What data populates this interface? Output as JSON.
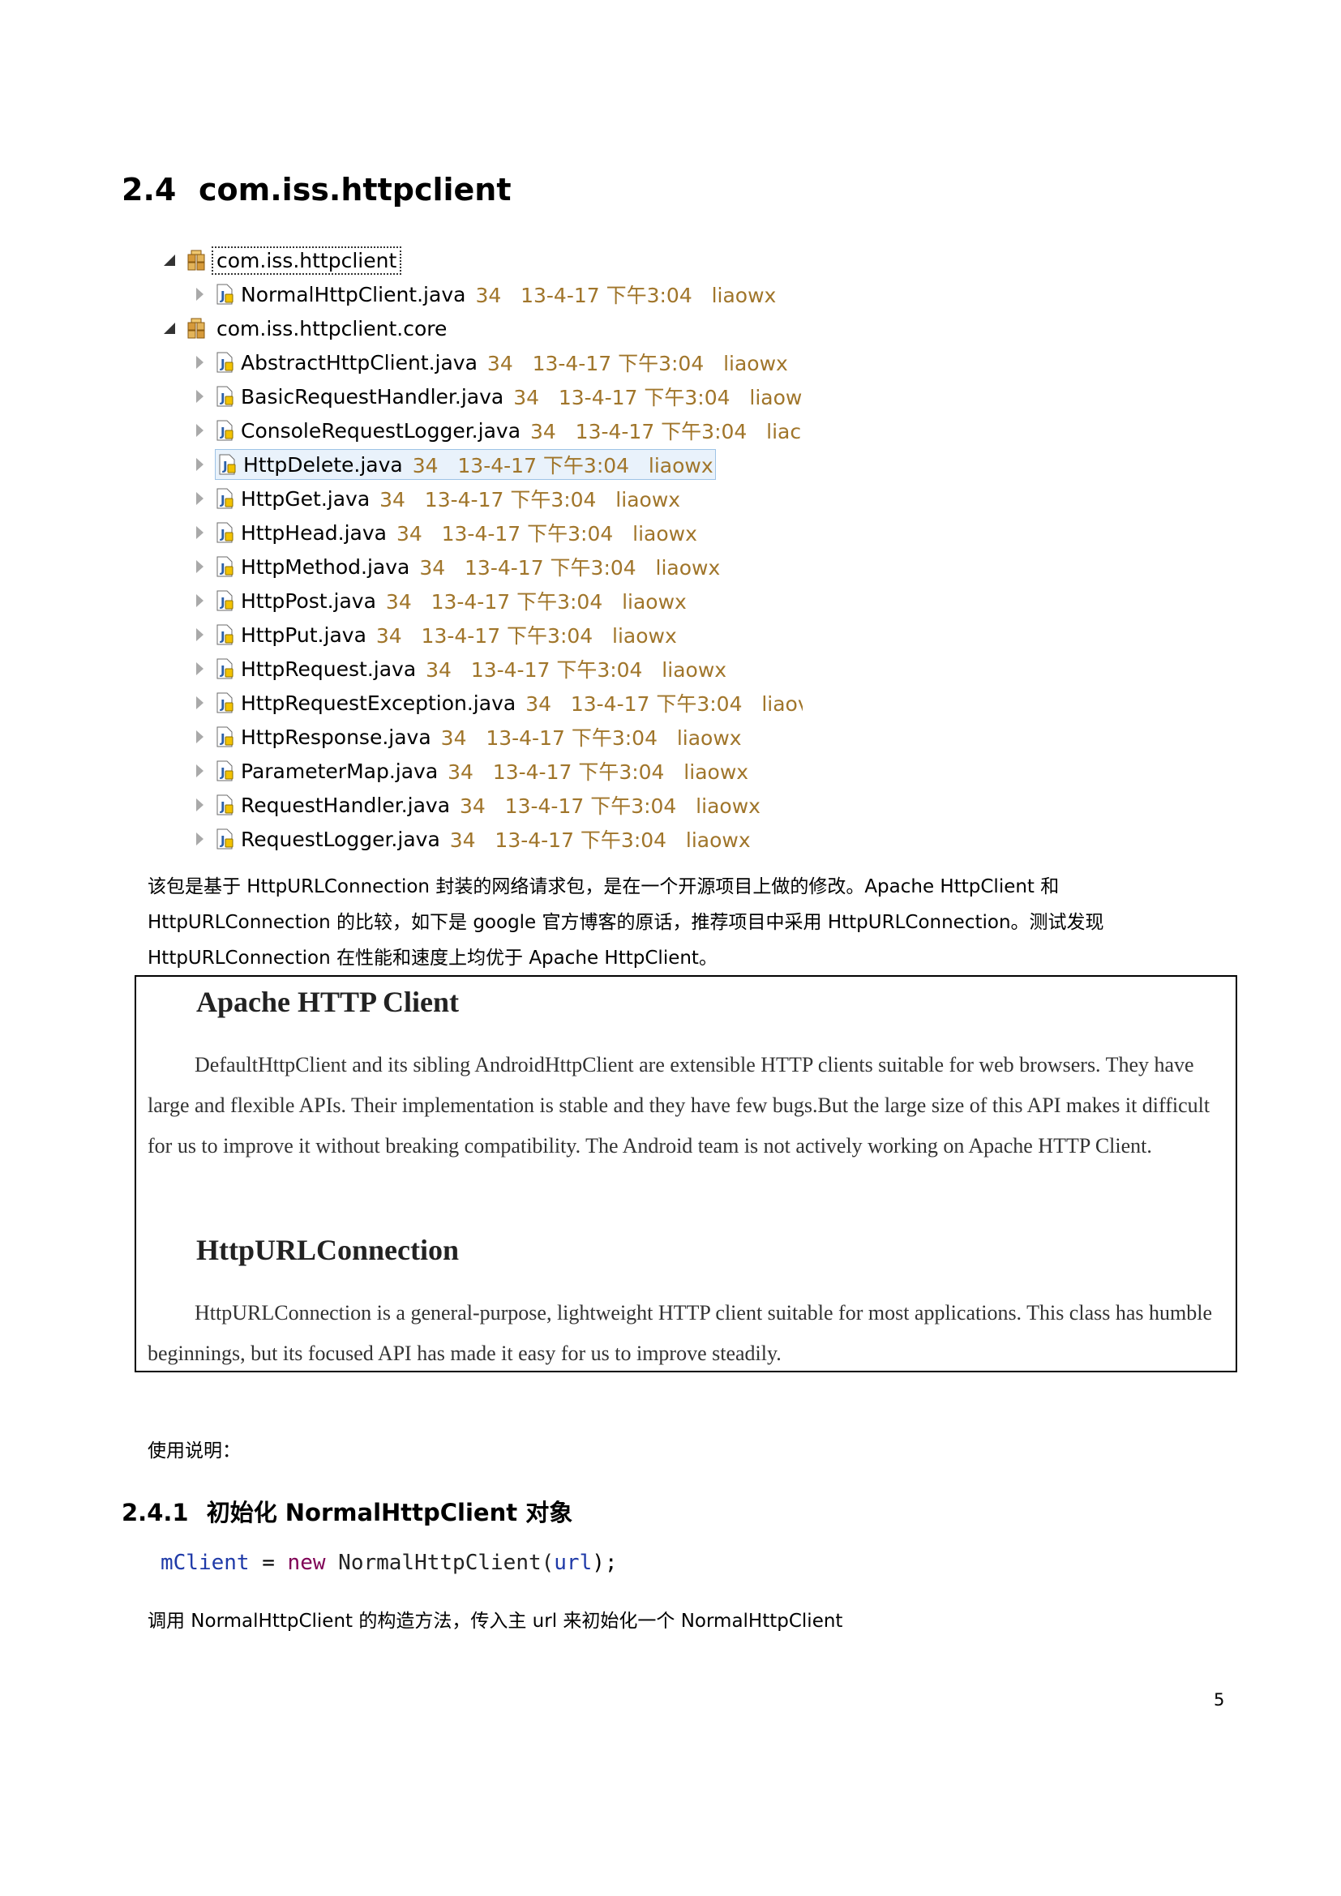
{
  "section": {
    "number": "2.4",
    "title": "com.iss.httpclient"
  },
  "tree": {
    "packages": [
      {
        "name": "com.iss.httpclient",
        "files": [
          {
            "name": "NormalHttpClient.java",
            "meta": "34   13-4-17 下午3:04   liaowx"
          }
        ]
      },
      {
        "name": "com.iss.httpclient.core",
        "files": [
          {
            "name": "AbstractHttpClient.java",
            "meta": "34   13-4-17 下午3:04   liaowx"
          },
          {
            "name": "BasicRequestHandler.java",
            "meta": "34   13-4-17 下午3:04   liaow:"
          },
          {
            "name": "ConsoleRequestLogger.java",
            "meta": "34   13-4-17 下午3:04   liac"
          },
          {
            "name": "HttpDelete.java",
            "meta": "34   13-4-17 下午3:04   liaowx"
          },
          {
            "name": "HttpGet.java",
            "meta": "34   13-4-17 下午3:04   liaowx"
          },
          {
            "name": "HttpHead.java",
            "meta": "34   13-4-17 下午3:04   liaowx"
          },
          {
            "name": "HttpMethod.java",
            "meta": "34   13-4-17 下午3:04   liaowx"
          },
          {
            "name": "HttpPost.java",
            "meta": "34   13-4-17 下午3:04   liaowx"
          },
          {
            "name": "HttpPut.java",
            "meta": "34   13-4-17 下午3:04   liaowx"
          },
          {
            "name": "HttpRequest.java",
            "meta": "34   13-4-17 下午3:04   liaowx"
          },
          {
            "name": "HttpRequestException.java",
            "meta": "34   13-4-17 下午3:04   liaov"
          },
          {
            "name": "HttpResponse.java",
            "meta": "34   13-4-17 下午3:04   liaowx"
          },
          {
            "name": "ParameterMap.java",
            "meta": "34   13-4-17 下午3:04   liaowx"
          },
          {
            "name": "RequestHandler.java",
            "meta": "34   13-4-17 下午3:04   liaowx"
          },
          {
            "name": "RequestLogger.java",
            "meta": "34   13-4-17 下午3:04   liaowx"
          }
        ]
      }
    ]
  },
  "intro": {
    "line1": "该包是基于 HttpURLConnection 封装的网络请求包，是在一个开源项目上做的修改。Apache HttpClient  和",
    "line2": "HttpURLConnection 的比较，如下是 google 官方博客的原话，推荐项目中采用 HttpURLConnection。测试发现",
    "line3": "HttpURLConnection 在性能和速度上均优于 Apache HttpClient。"
  },
  "quote": {
    "title1": "Apache HTTP Client",
    "body1": "DefaultHttpClient and its sibling AndroidHttpClient are extensible HTTP clients suitable for web browsers. They have large and flexible APIs. Their implementation is stable and they have few bugs.But the large size of this API makes it difficult for us to improve it without breaking compatibility. The Android team is not actively working on Apache HTTP Client.",
    "title2": "HttpURLConnection",
    "body2": "HttpURLConnection is a general-purpose, lightweight HTTP client suitable for most applications. This class has humble beginnings, but its focused API has made it easy for us to improve steadily."
  },
  "usage_label": "使用说明：",
  "subsection": {
    "number": "2.4.1",
    "title": "初始化 NormalHttpClient 对象"
  },
  "code": {
    "var": "mClient",
    "op": " = ",
    "kw": "new",
    "cls": " NormalHttpClient(",
    "arg": "url",
    "end": ");"
  },
  "description": "调用 NormalHttpClient 的构造方法，传入主 url 来初始化一个 NormalHttpClient",
  "page_number": "5"
}
